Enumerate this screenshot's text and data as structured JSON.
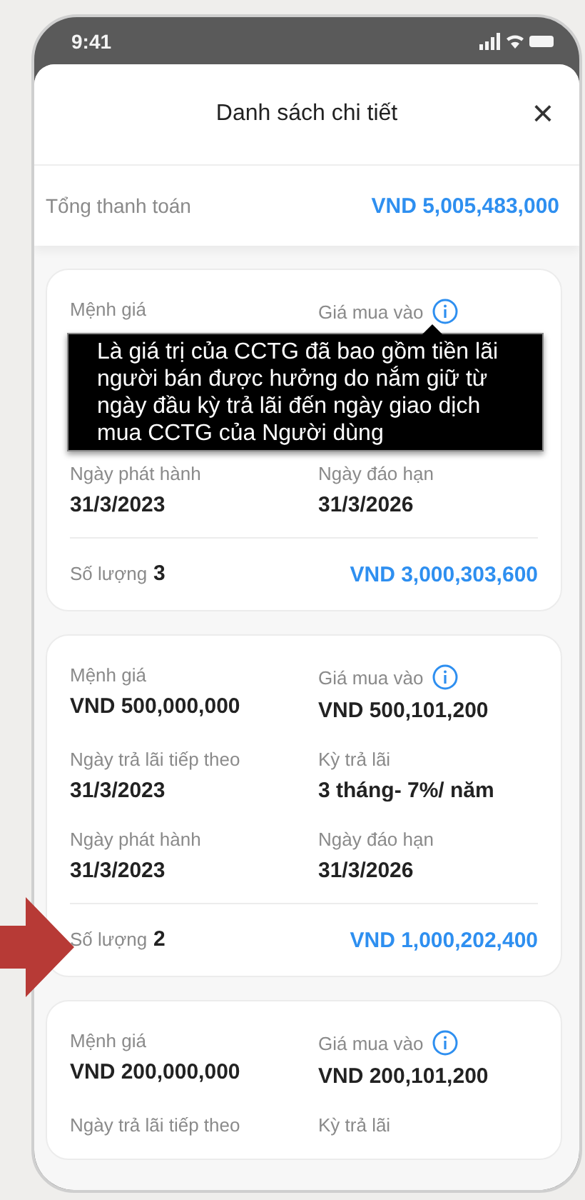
{
  "status_bar": {
    "time": "9:41"
  },
  "header": {
    "title": "Danh sách chi tiết",
    "close": "×"
  },
  "total": {
    "label": "Tổng thanh toán",
    "amount": "VND 5,005,483,000"
  },
  "cards": [
    {
      "sections": [
        {
          "kind": "fields",
          "fields": [
            {
              "label": "Mệnh giá",
              "info": false
            },
            {
              "label": "Giá mua vào",
              "info": true
            }
          ]
        },
        {
          "kind": "tooltip",
          "text": "Là giá trị của CCTG đã bao gồm tiền lãi người bán được hưởng do nắm giữ từ ngày đầu kỳ trả lãi đến ngày giao dịch mua CCTG của Người dùng"
        },
        {
          "kind": "fields",
          "fields": [
            {
              "label": "Ngày phát hành",
              "value": "31/3/2023",
              "info": false
            },
            {
              "label": "Ngày đáo hạn",
              "value": "31/3/2026",
              "info": false
            }
          ]
        },
        {
          "kind": "summary",
          "label": "Số lượng",
          "count": "3",
          "amount": "VND 3,000,303,600"
        }
      ]
    },
    {
      "sections": [
        {
          "kind": "fields",
          "fields": [
            {
              "label": "Mệnh giá",
              "value": "VND 500,000,000",
              "info": false
            },
            {
              "label": "Giá mua vào",
              "value": "VND 500,101,200",
              "info": true
            },
            {
              "label": "Ngày trả lãi tiếp theo",
              "value": "31/3/2023",
              "info": false
            },
            {
              "label": "Kỳ trả lãi",
              "value": "3 tháng- 7%/ năm",
              "info": false
            },
            {
              "label": "Ngày phát hành",
              "value": "31/3/2023",
              "info": false
            },
            {
              "label": "Ngày đáo hạn",
              "value": "31/3/2026",
              "info": false
            }
          ]
        },
        {
          "kind": "summary",
          "label": "Số lượng",
          "count": "2",
          "amount": "VND 1,000,202,400"
        }
      ]
    },
    {
      "sections": [
        {
          "kind": "fields",
          "fields": [
            {
              "label": "Mệnh giá",
              "value": "VND 200,000,000",
              "info": false
            },
            {
              "label": "Giá mua vào",
              "value": "VND 200,101,200",
              "info": true
            },
            {
              "label": "Ngày trả lãi tiếp theo",
              "info": false
            },
            {
              "label": "Kỳ trả lãi",
              "info": false
            }
          ]
        }
      ]
    }
  ]
}
